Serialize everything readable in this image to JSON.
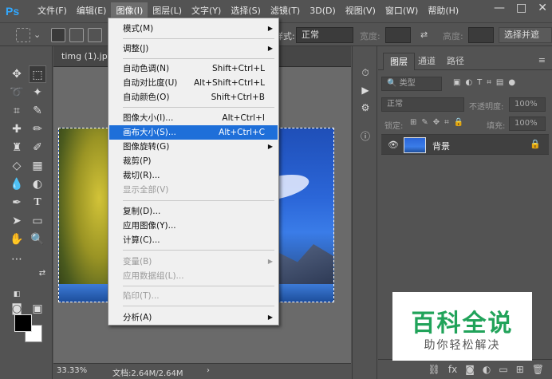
{
  "app": {
    "logo": "Ps"
  },
  "menubar": {
    "items": [
      "文件(F)",
      "编辑(E)",
      "图像(I)",
      "图层(L)",
      "文字(Y)",
      "选择(S)",
      "滤镜(T)",
      "3D(D)",
      "视图(V)",
      "窗口(W)",
      "帮助(H)"
    ],
    "open_index": 2
  },
  "window_controls": {
    "minimize": "—",
    "maximize": "□",
    "close": "✕"
  },
  "options_bar": {
    "style_label": "样式:",
    "style_value": "正常",
    "width_label": "宽度:",
    "height_label": "高度:",
    "select_button": "选择并遮"
  },
  "document": {
    "tab_title": "timg (1).jpg",
    "zoom": "33.33%",
    "doc_info": "文档:2.64M/2.64M"
  },
  "layers_panel": {
    "tabs": [
      "图层",
      "通道",
      "路径"
    ],
    "kind_placeholder": "类型",
    "blend_mode": "正常",
    "opacity_label": "不透明度:",
    "opacity_value": "100%",
    "lock_label": "锁定:",
    "fill_label": "填充:",
    "fill_value": "100%",
    "layer_name": "背景"
  },
  "image_menu": {
    "items": [
      {
        "label": "模式(M)",
        "submenu": true
      },
      {
        "label": "调整(J)",
        "submenu": true
      },
      {
        "label": "自动色调(N)",
        "shortcut": "Shift+Ctrl+L"
      },
      {
        "label": "自动对比度(U)",
        "shortcut": "Alt+Shift+Ctrl+L"
      },
      {
        "label": "自动颜色(O)",
        "shortcut": "Shift+Ctrl+B"
      },
      {
        "label": "图像大小(I)...",
        "shortcut": "Alt+Ctrl+I"
      },
      {
        "label": "画布大小(S)...",
        "shortcut": "Alt+Ctrl+C",
        "highlighted": true
      },
      {
        "label": "图像旋转(G)",
        "submenu": true
      },
      {
        "label": "裁剪(P)"
      },
      {
        "label": "裁切(R)..."
      },
      {
        "label": "显示全部(V)",
        "disabled": true
      },
      {
        "label": "复制(D)..."
      },
      {
        "label": "应用图像(Y)..."
      },
      {
        "label": "计算(C)..."
      },
      {
        "label": "变量(B)",
        "submenu": true,
        "disabled": true
      },
      {
        "label": "应用数据组(L)...",
        "disabled": true
      },
      {
        "label": "陷印(T)...",
        "disabled": true
      },
      {
        "label": "分析(A)",
        "submenu": true
      }
    ]
  },
  "watermark": {
    "title": "百科全说",
    "subtitle": "助你轻松解决"
  },
  "colors": {
    "highlight": "#1e6fd9",
    "brand": "#21a35a",
    "ps_blue": "#31a8ff"
  }
}
